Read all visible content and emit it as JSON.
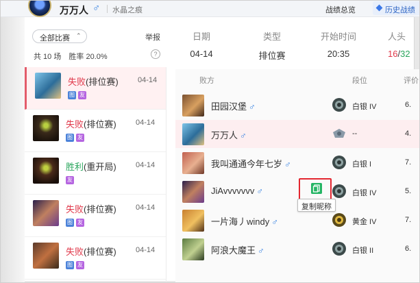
{
  "header": {
    "player_name": "万万人",
    "gender_symbol": "♂",
    "server": "水晶之痕",
    "overview_label": "战绩总览",
    "history_label": "历史战绩"
  },
  "sidebar": {
    "filter_label": "全部比赛",
    "filter_caret": "⌃",
    "report_label": "举报",
    "count_text": "共 10 场",
    "winrate_text": "胜率 20.0%",
    "help_glyph": "?",
    "matches": [
      {
        "result": "失败",
        "result_type": "loss",
        "mode": "(排位赛)",
        "date": "04-14",
        "tags": [
          "图",
          "友"
        ]
      },
      {
        "result": "失败",
        "result_type": "loss",
        "mode": "(排位赛)",
        "date": "04-14",
        "tags": [
          "图",
          "友"
        ]
      },
      {
        "result": "胜利",
        "result_type": "win",
        "mode": "(重开局)",
        "date": "04-14",
        "tags": [
          "友"
        ]
      },
      {
        "result": "失败",
        "result_type": "loss",
        "mode": "(排位赛)",
        "date": "04-14",
        "tags": [
          "图",
          "友"
        ]
      },
      {
        "result": "失败",
        "result_type": "loss",
        "mode": "(排位赛)",
        "date": "04-14",
        "tags": [
          "图",
          "友"
        ]
      }
    ]
  },
  "detail": {
    "date_label": "日期",
    "date_value": "04-14",
    "type_label": "类型",
    "type_value": "排位赛",
    "start_label": "开始时间",
    "start_value": "20:35",
    "people_label": "人头",
    "kills_lose": "16",
    "kills_sep": "/",
    "kills_win": "32"
  },
  "team": {
    "side_label": "败方",
    "rank_col": "段位",
    "score_col": "评价",
    "players": [
      {
        "name": "田园汉堡",
        "gender": "♂",
        "rank": "白银 IV",
        "score": "6.",
        "me": false
      },
      {
        "name": "万万人",
        "gender": "♂",
        "rank": "--",
        "score": "4.",
        "me": true
      },
      {
        "name": "我叫通通今年七岁",
        "gender": "♂",
        "rank": "白银 I",
        "score": "7.",
        "me": false
      },
      {
        "name": "JiAvvvvvvv",
        "gender": "♂",
        "rank": "白银 IV",
        "score": "5.",
        "me": false
      },
      {
        "name": "一片海丿windy",
        "gender": "♂",
        "rank": "黄金 IV",
        "score": "7.",
        "me": false
      },
      {
        "name": "阿浪大魔王",
        "gender": "♂",
        "rank": "白银 II",
        "score": "6.",
        "me": false
      }
    ]
  },
  "copy": {
    "tooltip": "复制昵称"
  }
}
